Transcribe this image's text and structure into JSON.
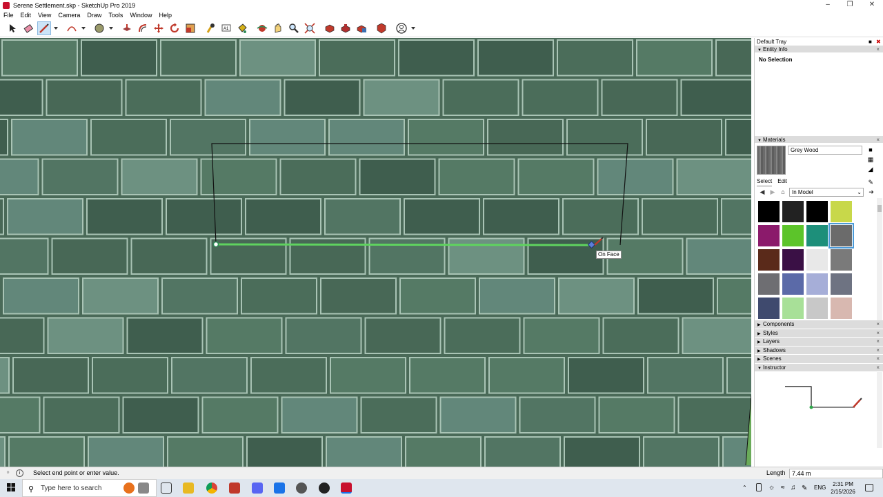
{
  "window": {
    "title": "Serene Settlement.skp - SketchUp Pro 2019",
    "controls": [
      "–",
      "❐",
      "✕"
    ]
  },
  "menu": [
    "File",
    "Edit",
    "View",
    "Camera",
    "Draw",
    "Tools",
    "Window",
    "Help"
  ],
  "toolbar": {
    "tools": [
      "select-tool",
      "eraser-tool",
      "line-tool",
      "line-dropdown",
      "arc-tool",
      "arc-dropdown",
      "shape-tool",
      "shape-dropdown",
      "push-pull-tool",
      "offset-tool",
      "move-tool",
      "rotate-tool",
      "scale-tool",
      "tape-measure-tool",
      "text-tool",
      "paint-bucket-tool",
      "orbit-tool",
      "pan-tool",
      "zoom-tool",
      "zoom-extents-tool",
      "warehouse-tool",
      "extension-warehouse-tool",
      "send-to-layout-tool",
      "extension-manager-tool",
      "account-tool",
      "account-dropdown"
    ]
  },
  "viewport": {
    "tooltip": "On Face",
    "inference_color": "#5fd35f"
  },
  "tray": {
    "title": "Default Tray",
    "entity_info": {
      "header": "Entity Info",
      "text": "No Selection"
    },
    "materials": {
      "header": "Materials",
      "current_name": "Grey Wood",
      "tabs": [
        "Select",
        "Edit"
      ],
      "collection": "In Model",
      "swatch_colors": [
        "#000000",
        "#222222",
        "#000000",
        "#c8d84a",
        "#8b1a6b",
        "#5cc42a",
        "#1d8f7a",
        "#6b6b6b",
        "#5a2a1a",
        "#3a1045",
        "#e8e8e8",
        "#7a7a7a",
        "#6e6e72",
        "#5b6aa8",
        "#a6aed8",
        "#6e7382",
        "#3f4a6e",
        "#a8e098",
        "#c8c8c8",
        "#d8b8b0"
      ]
    },
    "collapsed": [
      "Components",
      "Styles",
      "Layers",
      "Shadows",
      "Scenes"
    ],
    "instructor": {
      "header": "Instructor"
    }
  },
  "status": {
    "message": "Select end point or enter value.",
    "vcb_label": "Length",
    "vcb_value": "7.44 m"
  },
  "taskbar": {
    "search_placeholder": "Type here to search",
    "language": "ENG",
    "time": "2:31 PM",
    "date": "2/15/2026"
  }
}
